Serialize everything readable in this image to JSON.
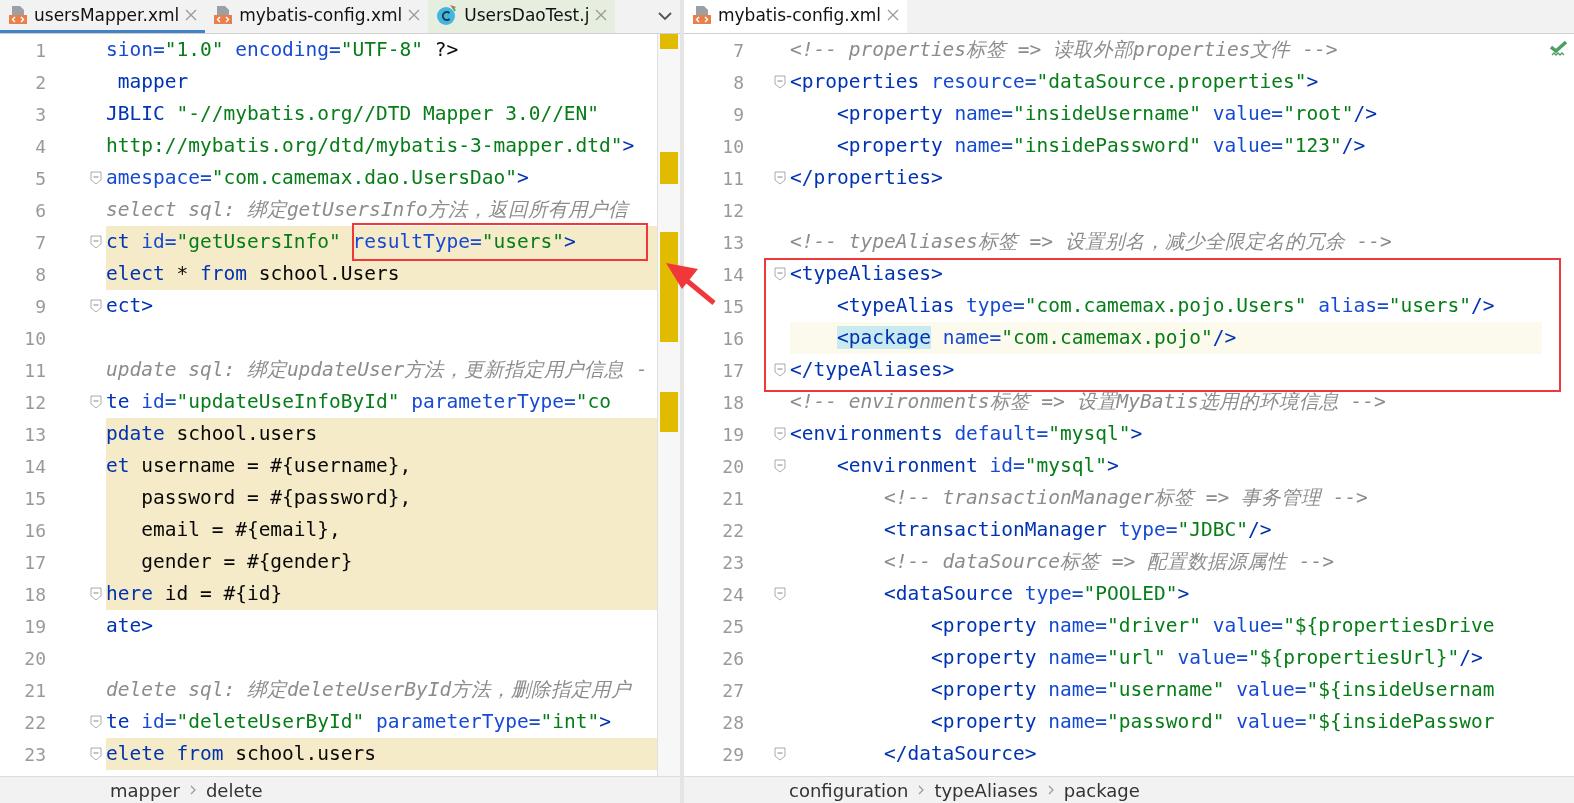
{
  "panes": [
    {
      "tabs": [
        {
          "label": "usersMapper.xml",
          "kind": "xml",
          "selected": true
        },
        {
          "label": "mybatis-config.xml",
          "kind": "xml",
          "selected": false
        },
        {
          "label": "UsersDaoTest.j",
          "kind": "class",
          "selected": false
        }
      ],
      "lines": [
        {
          "number": "1",
          "highlighted": false,
          "fold": false,
          "segments": [
            {
              "kind": "attr",
              "text": "sion="
            },
            {
              "kind": "value",
              "text": "\"1.0\" "
            },
            {
              "kind": "attr",
              "text": "encoding="
            },
            {
              "kind": "value",
              "text": "\"UTF-8\""
            },
            {
              "kind": "plain",
              "text": " ?>"
            }
          ]
        },
        {
          "number": "2",
          "highlighted": false,
          "fold": false,
          "segments": [
            {
              "kind": "tag",
              "text": " mapper"
            }
          ]
        },
        {
          "number": "3",
          "highlighted": false,
          "fold": false,
          "segments": [
            {
              "kind": "tag",
              "text": "JBLIC "
            },
            {
              "kind": "value",
              "text": "\"-//mybatis.org//DTD Mapper 3.0//EN\""
            }
          ]
        },
        {
          "number": "4",
          "highlighted": false,
          "fold": false,
          "segments": [
            {
              "kind": "value",
              "text": "http://mybatis.org/dtd/mybatis-3-mapper.dtd\""
            },
            {
              "kind": "tag",
              "text": ">"
            }
          ]
        },
        {
          "number": "5",
          "highlighted": false,
          "fold": true,
          "segments": [
            {
              "kind": "attr",
              "text": "amespace="
            },
            {
              "kind": "value",
              "text": "\"com.camemax.dao.UsersDao\""
            },
            {
              "kind": "tag",
              "text": ">"
            }
          ]
        },
        {
          "number": "6",
          "highlighted": false,
          "fold": false,
          "segments": [
            {
              "kind": "comment",
              "text": "select sql: 绑定getUsersInfo方法，返回所有用户信"
            }
          ]
        },
        {
          "number": "7",
          "highlighted": true,
          "fold": true,
          "segments": [
            {
              "kind": "tag",
              "text": "ct "
            },
            {
              "kind": "attr",
              "text": "id="
            },
            {
              "kind": "value",
              "text": "\"getUsersInfo\" "
            },
            {
              "kind": "attr",
              "text": "resultType="
            },
            {
              "kind": "value",
              "text": "\"users\""
            },
            {
              "kind": "tag",
              "text": ">"
            }
          ]
        },
        {
          "number": "8",
          "highlighted": true,
          "fold": false,
          "segments": [
            {
              "kind": "tag",
              "text": "elect"
            },
            {
              "kind": "plain",
              "text": " * "
            },
            {
              "kind": "tag",
              "text": "from"
            },
            {
              "kind": "plain",
              "text": " school.Users"
            }
          ]
        },
        {
          "number": "9",
          "highlighted": false,
          "fold": true,
          "segments": [
            {
              "kind": "tag",
              "text": "ect>"
            }
          ]
        },
        {
          "number": "10",
          "highlighted": false,
          "fold": false
        },
        {
          "number": "11",
          "highlighted": false,
          "fold": false,
          "segments": [
            {
              "kind": "comment",
              "text": "update sql: 绑定updateUser方法，更新指定用户信息 -"
            }
          ]
        },
        {
          "number": "12",
          "highlighted": false,
          "fold": true,
          "segments": [
            {
              "kind": "tag",
              "text": "te "
            },
            {
              "kind": "attr",
              "text": "id="
            },
            {
              "kind": "value",
              "text": "\"updateUseInfoById\" "
            },
            {
              "kind": "attr",
              "text": "parameterType="
            },
            {
              "kind": "value",
              "text": "\"co"
            }
          ]
        },
        {
          "number": "13",
          "highlighted": true,
          "fold": false,
          "segments": [
            {
              "kind": "tag",
              "text": "pdate"
            },
            {
              "kind": "plain",
              "text": " school.users"
            }
          ]
        },
        {
          "number": "14",
          "highlighted": true,
          "fold": false,
          "segments": [
            {
              "kind": "tag",
              "text": "et"
            },
            {
              "kind": "plain",
              "text": " username = #{username},"
            }
          ]
        },
        {
          "number": "15",
          "highlighted": true,
          "fold": false,
          "segments": [
            {
              "kind": "plain",
              "text": "   password = #{password},"
            }
          ]
        },
        {
          "number": "16",
          "highlighted": true,
          "fold": false,
          "segments": [
            {
              "kind": "plain",
              "text": "   email = #{email},"
            }
          ]
        },
        {
          "number": "17",
          "highlighted": true,
          "fold": false,
          "segments": [
            {
              "kind": "plain",
              "text": "   gender = #{gender}"
            }
          ]
        },
        {
          "number": "18",
          "highlighted": true,
          "fold": true,
          "segments": [
            {
              "kind": "tag",
              "text": "here"
            },
            {
              "kind": "plain",
              "text": " id = #{id}"
            }
          ]
        },
        {
          "number": "19",
          "highlighted": false,
          "fold": false,
          "segments": [
            {
              "kind": "tag",
              "text": "ate>"
            }
          ]
        },
        {
          "number": "20",
          "highlighted": false,
          "fold": false
        },
        {
          "number": "21",
          "highlighted": false,
          "fold": false,
          "segments": [
            {
              "kind": "comment",
              "text": "delete sql: 绑定deleteUserById方法，删除指定用户"
            }
          ]
        },
        {
          "number": "22",
          "highlighted": false,
          "fold": true,
          "segments": [
            {
              "kind": "tag",
              "text": "te "
            },
            {
              "kind": "attr",
              "text": "id="
            },
            {
              "kind": "value",
              "text": "\"deleteUserById\" "
            },
            {
              "kind": "attr",
              "text": "parameterType="
            },
            {
              "kind": "value",
              "text": "\"int\""
            },
            {
              "kind": "tag",
              "text": ">"
            }
          ]
        },
        {
          "number": "23",
          "highlighted": true,
          "fold": true,
          "segments": [
            {
              "kind": "tag",
              "text": "elete from"
            },
            {
              "kind": "plain",
              "text": " school.users"
            }
          ]
        }
      ],
      "breadcrumbs": [
        "mapper",
        "delete"
      ]
    },
    {
      "tabs": [
        {
          "label": "mybatis-config.xml",
          "kind": "xml",
          "selected": true
        }
      ],
      "lines": [
        {
          "number": "7",
          "highlighted": false,
          "fold": false,
          "segments": [
            {
              "kind": "comment",
              "text": "<!-- properties标签 => 读取外部properties文件 -->"
            }
          ]
        },
        {
          "number": "8",
          "highlighted": false,
          "fold": true,
          "segments": [
            {
              "kind": "tag",
              "text": "<properties "
            },
            {
              "kind": "attr",
              "text": "resource="
            },
            {
              "kind": "value",
              "text": "\"dataSource.properties\""
            },
            {
              "kind": "tag",
              "text": ">"
            }
          ]
        },
        {
          "number": "9",
          "highlighted": false,
          "fold": false,
          "segments": [
            {
              "kind": "tag",
              "text": "    <property "
            },
            {
              "kind": "attr",
              "text": "name="
            },
            {
              "kind": "value",
              "text": "\"insideUsername\" "
            },
            {
              "kind": "attr",
              "text": "value="
            },
            {
              "kind": "value",
              "text": "\"root\""
            },
            {
              "kind": "tag",
              "text": "/>"
            }
          ]
        },
        {
          "number": "10",
          "highlighted": false,
          "fold": false,
          "segments": [
            {
              "kind": "tag",
              "text": "    <property "
            },
            {
              "kind": "attr",
              "text": "name="
            },
            {
              "kind": "value",
              "text": "\"insidePassword\" "
            },
            {
              "kind": "attr",
              "text": "value="
            },
            {
              "kind": "value",
              "text": "\"123\""
            },
            {
              "kind": "tag",
              "text": "/>"
            }
          ]
        },
        {
          "number": "11",
          "highlighted": false,
          "fold": true,
          "segments": [
            {
              "kind": "tag",
              "text": "</properties>"
            }
          ]
        },
        {
          "number": "12",
          "highlighted": false,
          "fold": false
        },
        {
          "number": "13",
          "highlighted": false,
          "fold": false,
          "segments": [
            {
              "kind": "comment",
              "text": "<!-- typeAliases标签 => 设置别名，减少全限定名的冗余 -->"
            }
          ]
        },
        {
          "number": "14",
          "highlighted": false,
          "fold": true,
          "segments": [
            {
              "kind": "tag",
              "text": "<typeAliases>"
            }
          ]
        },
        {
          "number": "15",
          "highlighted": false,
          "fold": false,
          "segments": [
            {
              "kind": "tag",
              "text": "    <typeAlias "
            },
            {
              "kind": "attr",
              "text": "type="
            },
            {
              "kind": "value",
              "text": "\"com.camemax.pojo.Users\" "
            },
            {
              "kind": "attr",
              "text": "alias="
            },
            {
              "kind": "value",
              "text": "\"users\""
            },
            {
              "kind": "tag",
              "text": "/>"
            }
          ]
        },
        {
          "number": "16",
          "highlighted": true,
          "fold": false,
          "segments": [
            {
              "kind": "match",
              "text": "    <package"
            },
            {
              "kind": "attr",
              "text": " name="
            },
            {
              "kind": "value",
              "text": "\"com.camemax.pojo\""
            },
            {
              "kind": "tag",
              "text": "/>"
            }
          ]
        },
        {
          "number": "17",
          "highlighted": false,
          "fold": true,
          "segments": [
            {
              "kind": "tag",
              "text": "</typeAliases>"
            }
          ]
        },
        {
          "number": "18",
          "highlighted": false,
          "fold": false,
          "segments": [
            {
              "kind": "comment",
              "text": "<!-- environments标签 => 设置MyBatis选用的环境信息 -->"
            }
          ]
        },
        {
          "number": "19",
          "highlighted": false,
          "fold": true,
          "segments": [
            {
              "kind": "tag",
              "text": "<environments "
            },
            {
              "kind": "attr",
              "text": "default="
            },
            {
              "kind": "value",
              "text": "\"mysql\""
            },
            {
              "kind": "tag",
              "text": ">"
            }
          ]
        },
        {
          "number": "20",
          "highlighted": false,
          "fold": true,
          "segments": [
            {
              "kind": "tag",
              "text": "    <environment "
            },
            {
              "kind": "attr",
              "text": "id="
            },
            {
              "kind": "value",
              "text": "\"mysql\""
            },
            {
              "kind": "tag",
              "text": ">"
            }
          ]
        },
        {
          "number": "21",
          "highlighted": false,
          "fold": false,
          "segments": [
            {
              "kind": "comment",
              "text": "        <!-- transactionManager标签 => 事务管理 -->"
            }
          ]
        },
        {
          "number": "22",
          "highlighted": false,
          "fold": false,
          "segments": [
            {
              "kind": "tag",
              "text": "        <transactionManager "
            },
            {
              "kind": "attr",
              "text": "type="
            },
            {
              "kind": "value",
              "text": "\"JDBC\""
            },
            {
              "kind": "tag",
              "text": "/>"
            }
          ]
        },
        {
          "number": "23",
          "highlighted": false,
          "fold": false,
          "segments": [
            {
              "kind": "comment",
              "text": "        <!-- dataSource标签 => 配置数据源属性 -->"
            }
          ]
        },
        {
          "number": "24",
          "highlighted": false,
          "fold": true,
          "segments": [
            {
              "kind": "tag",
              "text": "        <dataSource "
            },
            {
              "kind": "attr",
              "text": "type="
            },
            {
              "kind": "value",
              "text": "\"POOLED\""
            },
            {
              "kind": "tag",
              "text": ">"
            }
          ]
        },
        {
          "number": "25",
          "highlighted": false,
          "fold": false,
          "segments": [
            {
              "kind": "tag",
              "text": "            <property "
            },
            {
              "kind": "attr",
              "text": "name="
            },
            {
              "kind": "value",
              "text": "\"driver\" "
            },
            {
              "kind": "attr",
              "text": "value="
            },
            {
              "kind": "value",
              "text": "\"${propertiesDrive"
            }
          ]
        },
        {
          "number": "26",
          "highlighted": false,
          "fold": false,
          "segments": [
            {
              "kind": "tag",
              "text": "            <property "
            },
            {
              "kind": "attr",
              "text": "name="
            },
            {
              "kind": "value",
              "text": "\"url\" "
            },
            {
              "kind": "attr",
              "text": "value="
            },
            {
              "kind": "value",
              "text": "\"${propertiesUrl}\""
            },
            {
              "kind": "tag",
              "text": "/>"
            }
          ]
        },
        {
          "number": "27",
          "highlighted": false,
          "fold": false,
          "segments": [
            {
              "kind": "tag",
              "text": "            <property "
            },
            {
              "kind": "attr",
              "text": "name="
            },
            {
              "kind": "value",
              "text": "\"username\" "
            },
            {
              "kind": "attr",
              "text": "value="
            },
            {
              "kind": "value",
              "text": "\"${insideUsernam"
            }
          ]
        },
        {
          "number": "28",
          "highlighted": false,
          "fold": false,
          "segments": [
            {
              "kind": "tag",
              "text": "            <property "
            },
            {
              "kind": "attr",
              "text": "name="
            },
            {
              "kind": "value",
              "text": "\"password\" "
            },
            {
              "kind": "attr",
              "text": "value="
            },
            {
              "kind": "value",
              "text": "\"${insidePasswor"
            }
          ]
        },
        {
          "number": "29",
          "highlighted": false,
          "fold": true,
          "segments": [
            {
              "kind": "tag",
              "text": "        </dataSource>"
            }
          ]
        }
      ],
      "breadcrumbs": [
        "configuration",
        "typeAliases",
        "package"
      ]
    }
  ]
}
